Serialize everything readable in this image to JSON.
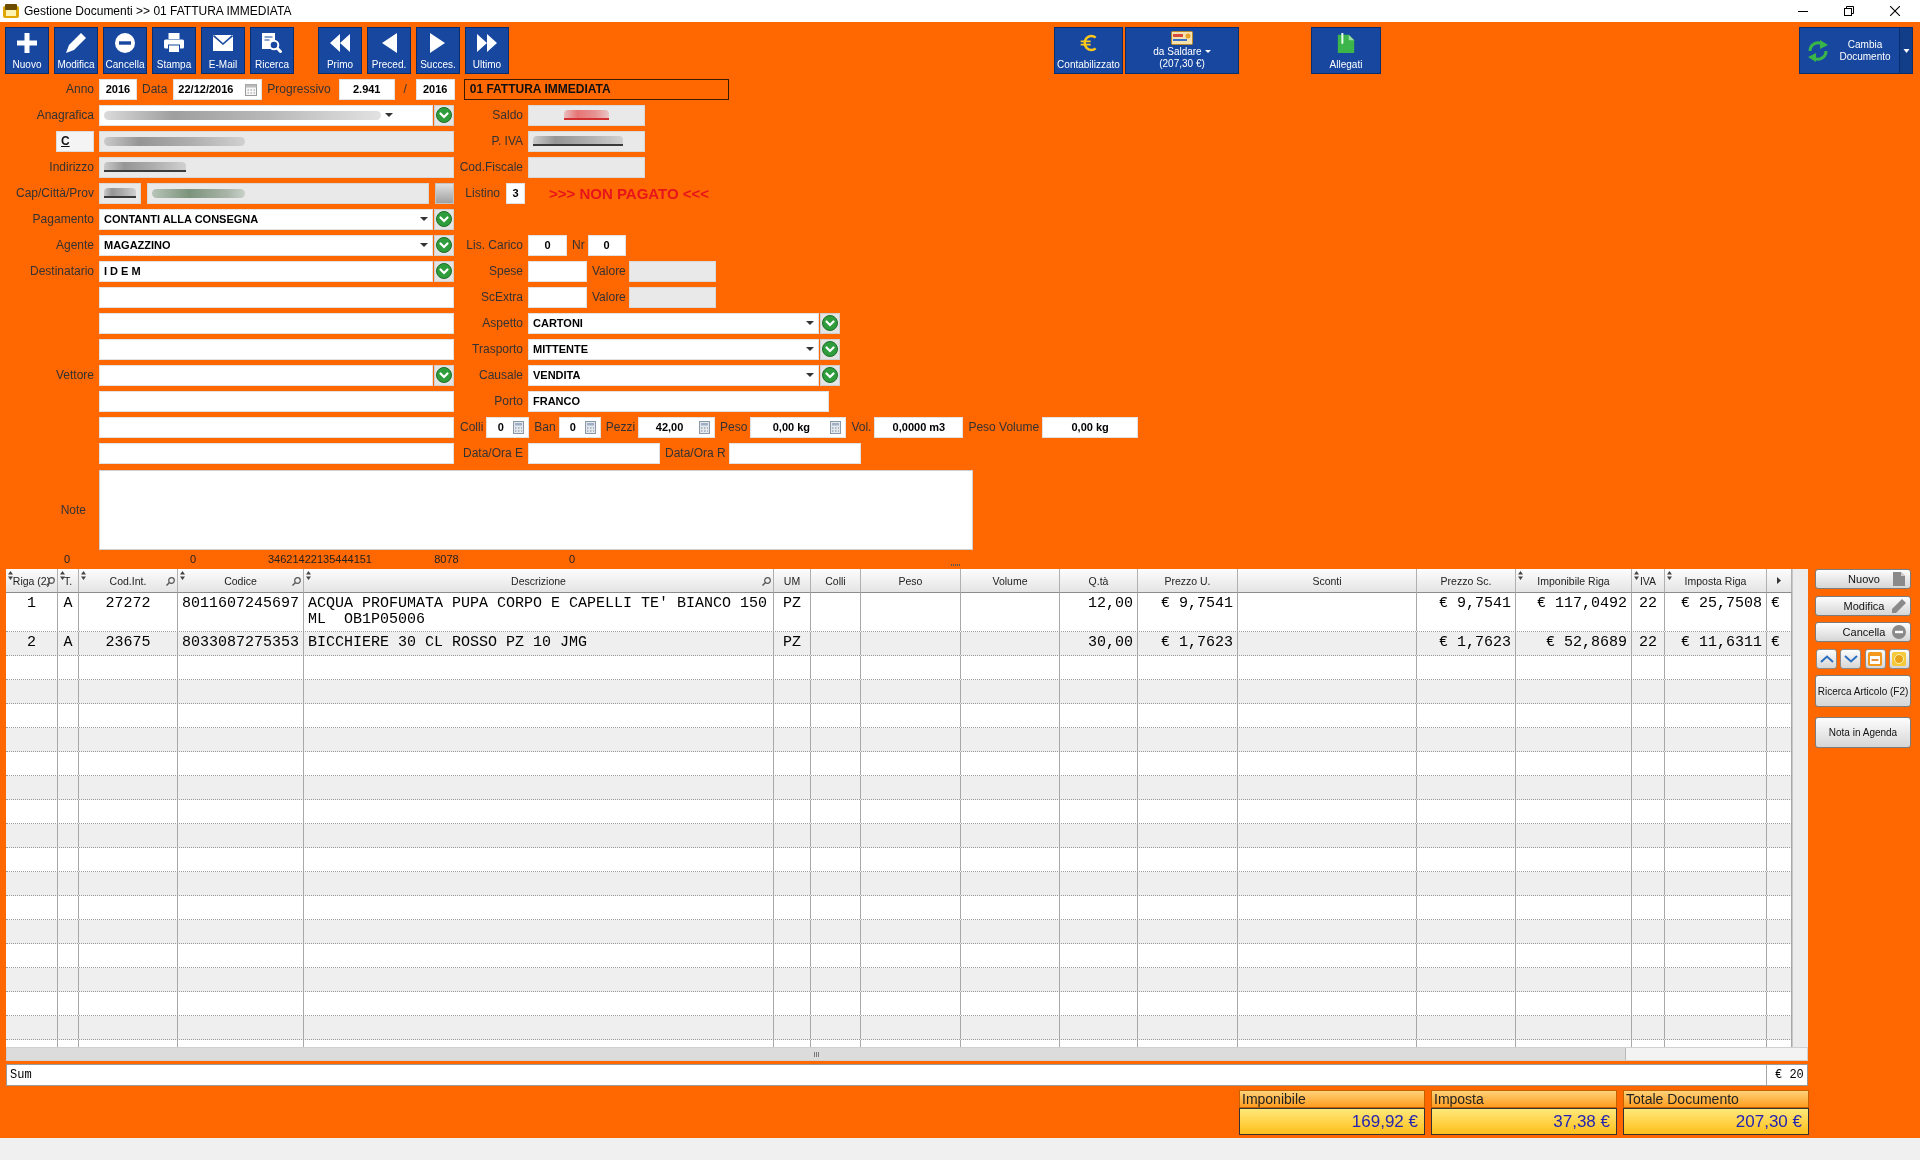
{
  "window": {
    "title": "Gestione Documenti >> 01 FATTURA IMMEDIATA"
  },
  "toolbar": {
    "edit": [
      "Nuovo",
      "Modifica",
      "Cancella",
      "Stampa",
      "E-Mail",
      "Ricerca"
    ],
    "navigation": [
      "Primo",
      "Preced.",
      "Succes.",
      "Ultimo"
    ],
    "contabilizzato": "Contabilizzato",
    "da_saldare": {
      "label": "da Saldare",
      "amount": "(207,30 €)"
    },
    "allegati": "Allegati",
    "cambia_documento": "Cambia Documento"
  },
  "header": {
    "anno": {
      "label": "Anno",
      "value": "2016"
    },
    "data": {
      "label": "Data",
      "value": "22/12/2016"
    },
    "progressivo": {
      "label": "Progressivo",
      "value": "2.941",
      "separator": "/",
      "year": "2016"
    },
    "document_type": "01 FATTURA IMMEDIATA"
  },
  "customer": [
    {
      "label": "Anagrafica",
      "kind": "combo",
      "redacted": true,
      "readonly": false
    },
    {
      "kind": "code",
      "code": "C",
      "redacted": true,
      "readonly": true
    },
    {
      "label": "Indirizzo",
      "kind": "text",
      "redacted": true,
      "readonly": true
    },
    {
      "label": "Cap/Città/Prov",
      "kind": "address",
      "redacted": true,
      "readonly": true
    },
    {
      "label": "Pagamento",
      "kind": "combo",
      "value": "CONTANTI ALLA CONSEGNA",
      "readonly": false
    },
    {
      "label": "Agente",
      "kind": "combo",
      "value": "MAGAZZINO",
      "readonly": false
    },
    {
      "label": "Destinatario",
      "kind": "lookup",
      "value": "I D E M",
      "readonly": false
    },
    {
      "kind": "text",
      "readonly": false
    },
    {
      "kind": "text",
      "readonly": false
    },
    {
      "kind": "text",
      "readonly": false
    },
    {
      "label": "Vettore",
      "kind": "lookup",
      "readonly": false
    },
    {
      "kind": "text",
      "readonly": false
    },
    {
      "kind": "text",
      "readonly": false
    },
    {
      "kind": "text",
      "readonly": false
    }
  ],
  "saldo": {
    "label": "Saldo",
    "redacted": true
  },
  "p_iva": {
    "label": "P. IVA",
    "redacted": true
  },
  "cod_fiscale": {
    "label": "Cod.Fiscale"
  },
  "listino": {
    "label": "Listino",
    "value": "3"
  },
  "payment_status": ">>> NON PAGATO <<<",
  "lis_carico": {
    "label": "Lis. Carico",
    "value": "0",
    "nr_label": "Nr",
    "nr_value": "0"
  },
  "spese": {
    "label": "Spese",
    "value_label": "Valore"
  },
  "sc_extra": {
    "label": "ScExtra",
    "value_label": "Valore"
  },
  "shipping": [
    {
      "label": "Aspetto",
      "value": "CARTONI"
    },
    {
      "label": "Trasporto",
      "value": "MITTENTE"
    },
    {
      "label": "Causale",
      "value": "VENDITA"
    }
  ],
  "porto": {
    "label": "Porto",
    "value": "FRANCO"
  },
  "measures": [
    {
      "label": "Colli",
      "value": "0",
      "calculator": true
    },
    {
      "label": "Ban",
      "value": "0",
      "calculator": true
    },
    {
      "label": "Pezzi",
      "value": "42,00",
      "calculator": true
    },
    {
      "label": "Peso",
      "value": "0,00 kg",
      "calculator": true
    },
    {
      "label": "Vol.",
      "value": "0,0000 m3",
      "calculator": false
    },
    {
      "label": "Peso Volume",
      "value": "0,00 kg",
      "calculator": false
    }
  ],
  "dates": [
    {
      "label": "Data/Ora E"
    },
    {
      "label": "Data/Ora R"
    }
  ],
  "note": {
    "label": "Note"
  },
  "counters": [
    "0",
    "0",
    "34621422135444151",
    "8078",
    "0"
  ],
  "table": {
    "columns": [
      {
        "label": "Riga (2)",
        "kind": "index",
        "sortable": true,
        "searchable": true
      },
      {
        "label": "T.",
        "kind": "index",
        "sortable": true
      },
      {
        "label": "Cod.Int.",
        "kind": "index",
        "sortable": true,
        "searchable": true
      },
      {
        "label": "Codice",
        "kind": "text",
        "sortable": true,
        "searchable": true
      },
      {
        "label": "Descrizione",
        "kind": "text",
        "sortable": true,
        "searchable": true
      },
      {
        "label": "UM",
        "kind": "index"
      },
      {
        "label": "Colli",
        "kind": "number"
      },
      {
        "label": "Peso",
        "kind": "number"
      },
      {
        "label": "Volume",
        "kind": "number"
      },
      {
        "label": "Q.tà",
        "kind": "number"
      },
      {
        "label": "Prezzo U.",
        "kind": "number"
      },
      {
        "label": "Sconti",
        "kind": "text"
      },
      {
        "label": "Prezzo Sc.",
        "kind": "number"
      },
      {
        "label": "Imponibile Riga",
        "kind": "number",
        "sortable": true
      },
      {
        "label": "IVA",
        "kind": "index",
        "sortable": true
      },
      {
        "label": "Imposta Riga",
        "kind": "number",
        "sortable": true
      },
      {
        "kind": "text"
      }
    ],
    "rows": [
      {
        "riga": "1",
        "t": "A",
        "cod_int": "27272",
        "codice": "8011607245697",
        "descrizione": "ACQUA PROFUMATA PUPA CORPO E CAPELLI TE' BIANCO 150 ML  OB1P05006",
        "um": "PZ",
        "qta": "12,00",
        "prezzo_u": "€ 9,7541",
        "prezzo_sc": "€ 9,7541",
        "imponibile_riga": "€ 117,0492",
        "iva": "22",
        "imposta_riga": "€ 25,7508",
        "column_17": "€"
      },
      {
        "riga": "2",
        "t": "A",
        "cod_int": "23675",
        "codice": "8033087275353",
        "descrizione": "BICCHIERE 30 CL ROSSO PZ 10 JMG",
        "um": "PZ",
        "qta": "30,00",
        "prezzo_u": "€ 1,7623",
        "prezzo_sc": "€ 1,7623",
        "imponibile_riga": "€ 52,8689",
        "iva": "22",
        "imposta_riga": "€ 11,6311",
        "column_17": "€"
      }
    ],
    "sum_label": "Sum",
    "sum_value": "€ 20"
  },
  "side_buttons": {
    "row_actions": [
      "Nuovo",
      "Modifica",
      "Cancella"
    ],
    "tools": [
      "Ricerca Articolo (F2)",
      "Nota in Agenda"
    ]
  },
  "totals": [
    {
      "label": "Imponibile",
      "value": "169,92 €"
    },
    {
      "label": "Imposta",
      "value": "37,38 €"
    },
    {
      "label": "Totale Documento",
      "value": "207,30 €"
    }
  ]
}
